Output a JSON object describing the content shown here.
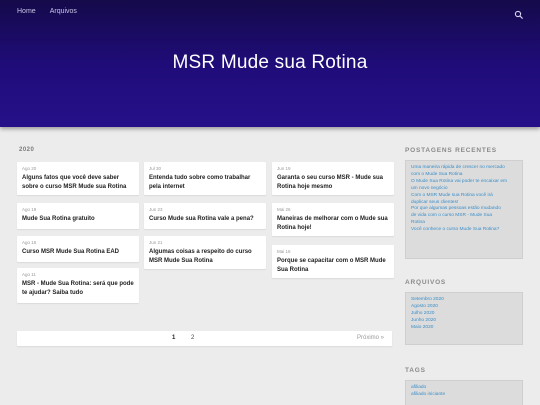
{
  "nav": {
    "home": "Home",
    "archives": "Arquivos"
  },
  "header": {
    "title": "MSR Mude sua Rotina"
  },
  "year_label": "2020",
  "posts": [
    {
      "date": "Ago 20",
      "title": "Alguns fatos que você deve saber sobre o curso MSR Mude sua Rotina"
    },
    {
      "date": "Jul 30",
      "title": "Entenda tudo sobre como trabalhar pela internet"
    },
    {
      "date": "Jun 19",
      "title": "Garanta o seu curso MSR - Mude sua Rotina hoje mesmo"
    },
    {
      "date": "Ago 19",
      "title": "Mude Sua Rotina gratuito"
    },
    {
      "date": "Jun 23",
      "title": "Curso Mude sua Rotina vale a pena?"
    },
    {
      "date": "Mai 26",
      "title": "Maneiras de melhorar com o Mude sua Rotina hoje!"
    },
    {
      "date": "Ago 15",
      "title": "Curso MSR Mude Sua Rotina EAD"
    },
    {
      "date": "Jun 21",
      "title": "Algumas coisas a respeito do curso MSR Mude Sua Rotina"
    },
    {
      "date": "Mai 16",
      "title": "Porque se capacitar com o MSR Mude Sua Rotina"
    },
    {
      "date": "Ago 11",
      "title": "MSR - Mude Sua Rotina: será que pode te ajudar? Saiba tudo"
    }
  ],
  "pagination": {
    "page1": "1",
    "page2": "2",
    "next": "Próximo »"
  },
  "sidebar": {
    "recent_heading": "POSTAGENS RECENTES",
    "recent": [
      "Uma maneira rápida de crescer no mercado",
      "com o Mude Sua Rotina",
      "O Mude Sua Rotina vai poder te encaixar em",
      "um novo negócio",
      "Com o MSR Mude sua Rotina você irá",
      "duplicar seus clientes!",
      "Por que algumas pessoas estão mudando",
      "de vida com o curso MSR - Mude Sua",
      "Rotina",
      "Você conhece o curso Mude Sua Rotina?"
    ],
    "archives_heading": "ARQUIVOS",
    "archives": [
      "Setembro 2020",
      "Agosto 2020",
      "Julho 2020",
      "Junho 2020",
      "Maio 2020"
    ],
    "tags_heading": "TAGS",
    "tags": [
      "afiliado",
      "afiliado iniciante"
    ]
  },
  "colors": {
    "header_bg": "#1f0c78",
    "link": "#3a8ec8"
  }
}
